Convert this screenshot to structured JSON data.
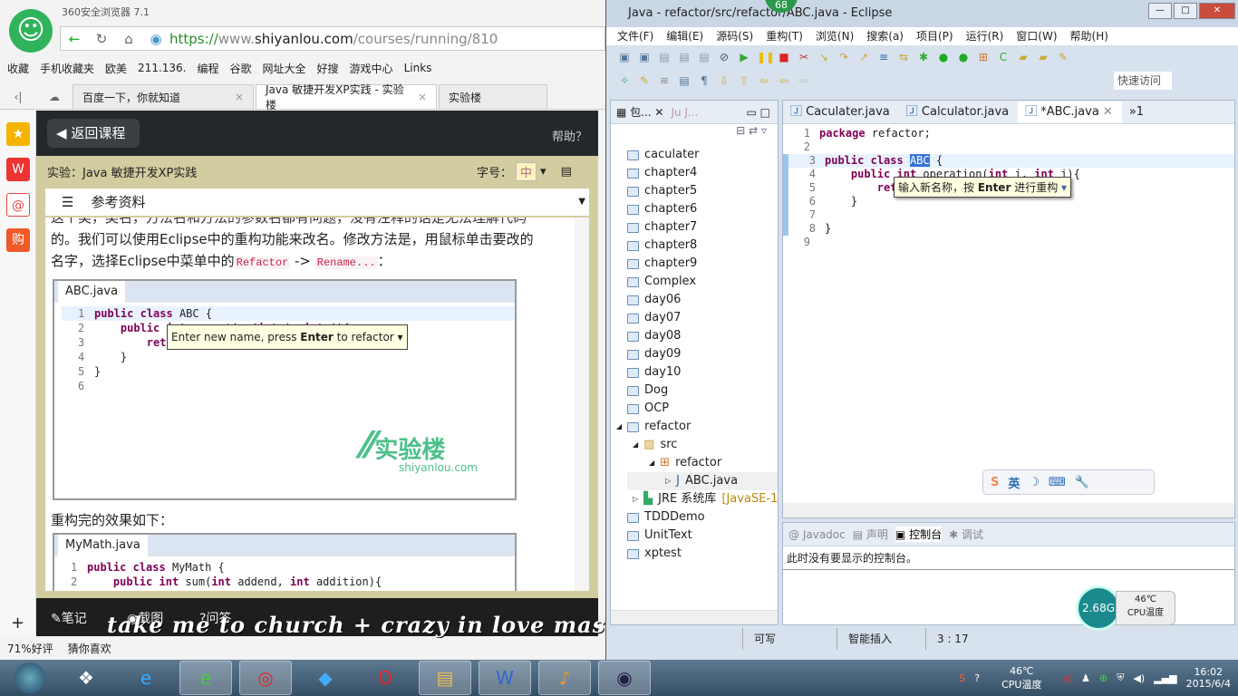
{
  "browser": {
    "app_title": "360安全浏览器 7.1",
    "url_scheme": "https://",
    "url_host_prefix": "www.",
    "url_host": "shiyanlou.com",
    "url_path": "/courses/running/810",
    "bookmarks": [
      "收藏",
      "手机收藏夹",
      "欧美",
      "211.136.",
      "编程",
      "谷歌",
      "网址大全",
      "好搜",
      "游戏中心",
      "Links"
    ],
    "tabs": [
      {
        "label": "百度一下，你就知道",
        "active": false
      },
      {
        "label": "Java 敏捷开发XP实践 - 实验楼",
        "active": true
      },
      {
        "label": "实验楼",
        "active": false
      }
    ],
    "status": {
      "rating": "71%好评",
      "guess": "猜你喜欢"
    }
  },
  "page": {
    "back_label": "返回课程",
    "help_label": "帮助？",
    "lab_title": "实验：Java 敏捷开发XP实践",
    "font_size_label": "字号：",
    "font_size_value": "中",
    "reference_label": "参考资料",
    "para_cut": "这个类，类名，方法名和方法的参数名都有问题，没有注释的话是无法理解代码",
    "para1": "的。我们可以使用Eclipse中的重构功能来改名。修改方法是，用鼠标单击要改的",
    "para2_prefix": "名字，选择Eclipse中菜单中的",
    "code_refactor": "Refactor",
    "arrow": " -> ",
    "code_rename": "Rename...",
    "para2_suffix": "：",
    "shot1": {
      "tab": "ABC.java",
      "tooltip_a": "Enter new name, press ",
      "tooltip_b": "Enter",
      "tooltip_c": " to refactor",
      "lines": [
        "public class ABC {",
        "    public int operation(int i, int j){",
        "        return i + j;}",
        "    }",
        "}",
        ""
      ],
      "logo_cn": "实验楼",
      "logo_en": "shiyanlou.com"
    },
    "after_label": "重构完的效果如下：",
    "shot2": {
      "tab": "MyMath.java",
      "lines": [
        "public class MyMath {",
        "    public int sum(int addend, int addition){"
      ]
    },
    "bottom": {
      "notes": "笔记",
      "screenshot": "截图",
      "qa": "问答",
      "lyric": "take me to church + crazy in love mashup - 未知"
    }
  },
  "eclipse": {
    "title": "Java - refactor/src/refactor/ABC.java - Eclipse",
    "badge": "68",
    "menu": [
      "文件(F)",
      "编辑(E)",
      "源码(S)",
      "重构(T)",
      "浏览(N)",
      "搜索(a)",
      "项目(P)",
      "运行(R)",
      "窗口(W)",
      "帮助(H)"
    ],
    "quick_access": "快速访问",
    "left_tabs": [
      "包...",
      "J..."
    ],
    "tree": [
      {
        "label": "caculater",
        "level": 0,
        "type": "project"
      },
      {
        "label": "chapter4",
        "level": 0,
        "type": "project"
      },
      {
        "label": "chapter5",
        "level": 0,
        "type": "project"
      },
      {
        "label": "chapter6",
        "level": 0,
        "type": "project"
      },
      {
        "label": "chapter7",
        "level": 0,
        "type": "project"
      },
      {
        "label": "chapter8",
        "level": 0,
        "type": "project"
      },
      {
        "label": "chapter9",
        "level": 0,
        "type": "project"
      },
      {
        "label": "Complex",
        "level": 0,
        "type": "project"
      },
      {
        "label": "day06",
        "level": 0,
        "type": "project"
      },
      {
        "label": "day07",
        "level": 0,
        "type": "project"
      },
      {
        "label": "day08",
        "level": 0,
        "type": "project"
      },
      {
        "label": "day09",
        "level": 0,
        "type": "project"
      },
      {
        "label": "day10",
        "level": 0,
        "type": "project"
      },
      {
        "label": "Dog",
        "level": 0,
        "type": "project"
      },
      {
        "label": "OCP",
        "level": 0,
        "type": "project"
      },
      {
        "label": "refactor",
        "level": 0,
        "type": "project",
        "expanded": true
      },
      {
        "label": "src",
        "level": 1,
        "type": "src",
        "expanded": true
      },
      {
        "label": "refactor",
        "level": 2,
        "type": "package",
        "expanded": true
      },
      {
        "label": "ABC.java",
        "level": 3,
        "type": "java"
      },
      {
        "label": "JRE 系统库",
        "suffix": "[JavaSE-1",
        "level": 1,
        "type": "lib"
      },
      {
        "label": "TDDDemo",
        "level": 0,
        "type": "project"
      },
      {
        "label": "UnitText",
        "level": 0,
        "type": "project"
      },
      {
        "label": "xptest",
        "level": 0,
        "type": "project"
      }
    ],
    "editor_tabs": [
      {
        "label": "Caculater.java",
        "active": false
      },
      {
        "label": "Calculator.java",
        "active": false
      },
      {
        "label": "*ABC.java",
        "active": true
      }
    ],
    "overflow": "»1",
    "code": [
      "package refactor;",
      "",
      "public class ABC {",
      "    public int operation(int i, int j){",
      "        return i + j;",
      "    }",
      "",
      "}",
      ""
    ],
    "tooltip_a": "输入新名称，按 ",
    "tooltip_b": "Enter",
    "tooltip_c": " 进行重构",
    "bottom_tabs": [
      "Javadoc",
      "声明",
      "控制台",
      "调试"
    ],
    "console_msg": "此时没有要显示的控制台。",
    "status": {
      "writable": "可写",
      "insert": "智能插入",
      "position": "3 : 17"
    },
    "cpu_widget": {
      "freq": "2.68G",
      "temp": "46℃",
      "label": "CPU温度"
    },
    "ime": {
      "mode": "英"
    }
  },
  "taskbar": {
    "tray_temp": "46℃",
    "tray_label": "CPU温度",
    "time": "16:02",
    "date": "2015/6/4"
  },
  "colors": {
    "accent_green": "#2fb35b",
    "eclipse_bg": "#d7e2ee",
    "keyword": "#7f0055",
    "page_olive": "#d2cda0"
  }
}
